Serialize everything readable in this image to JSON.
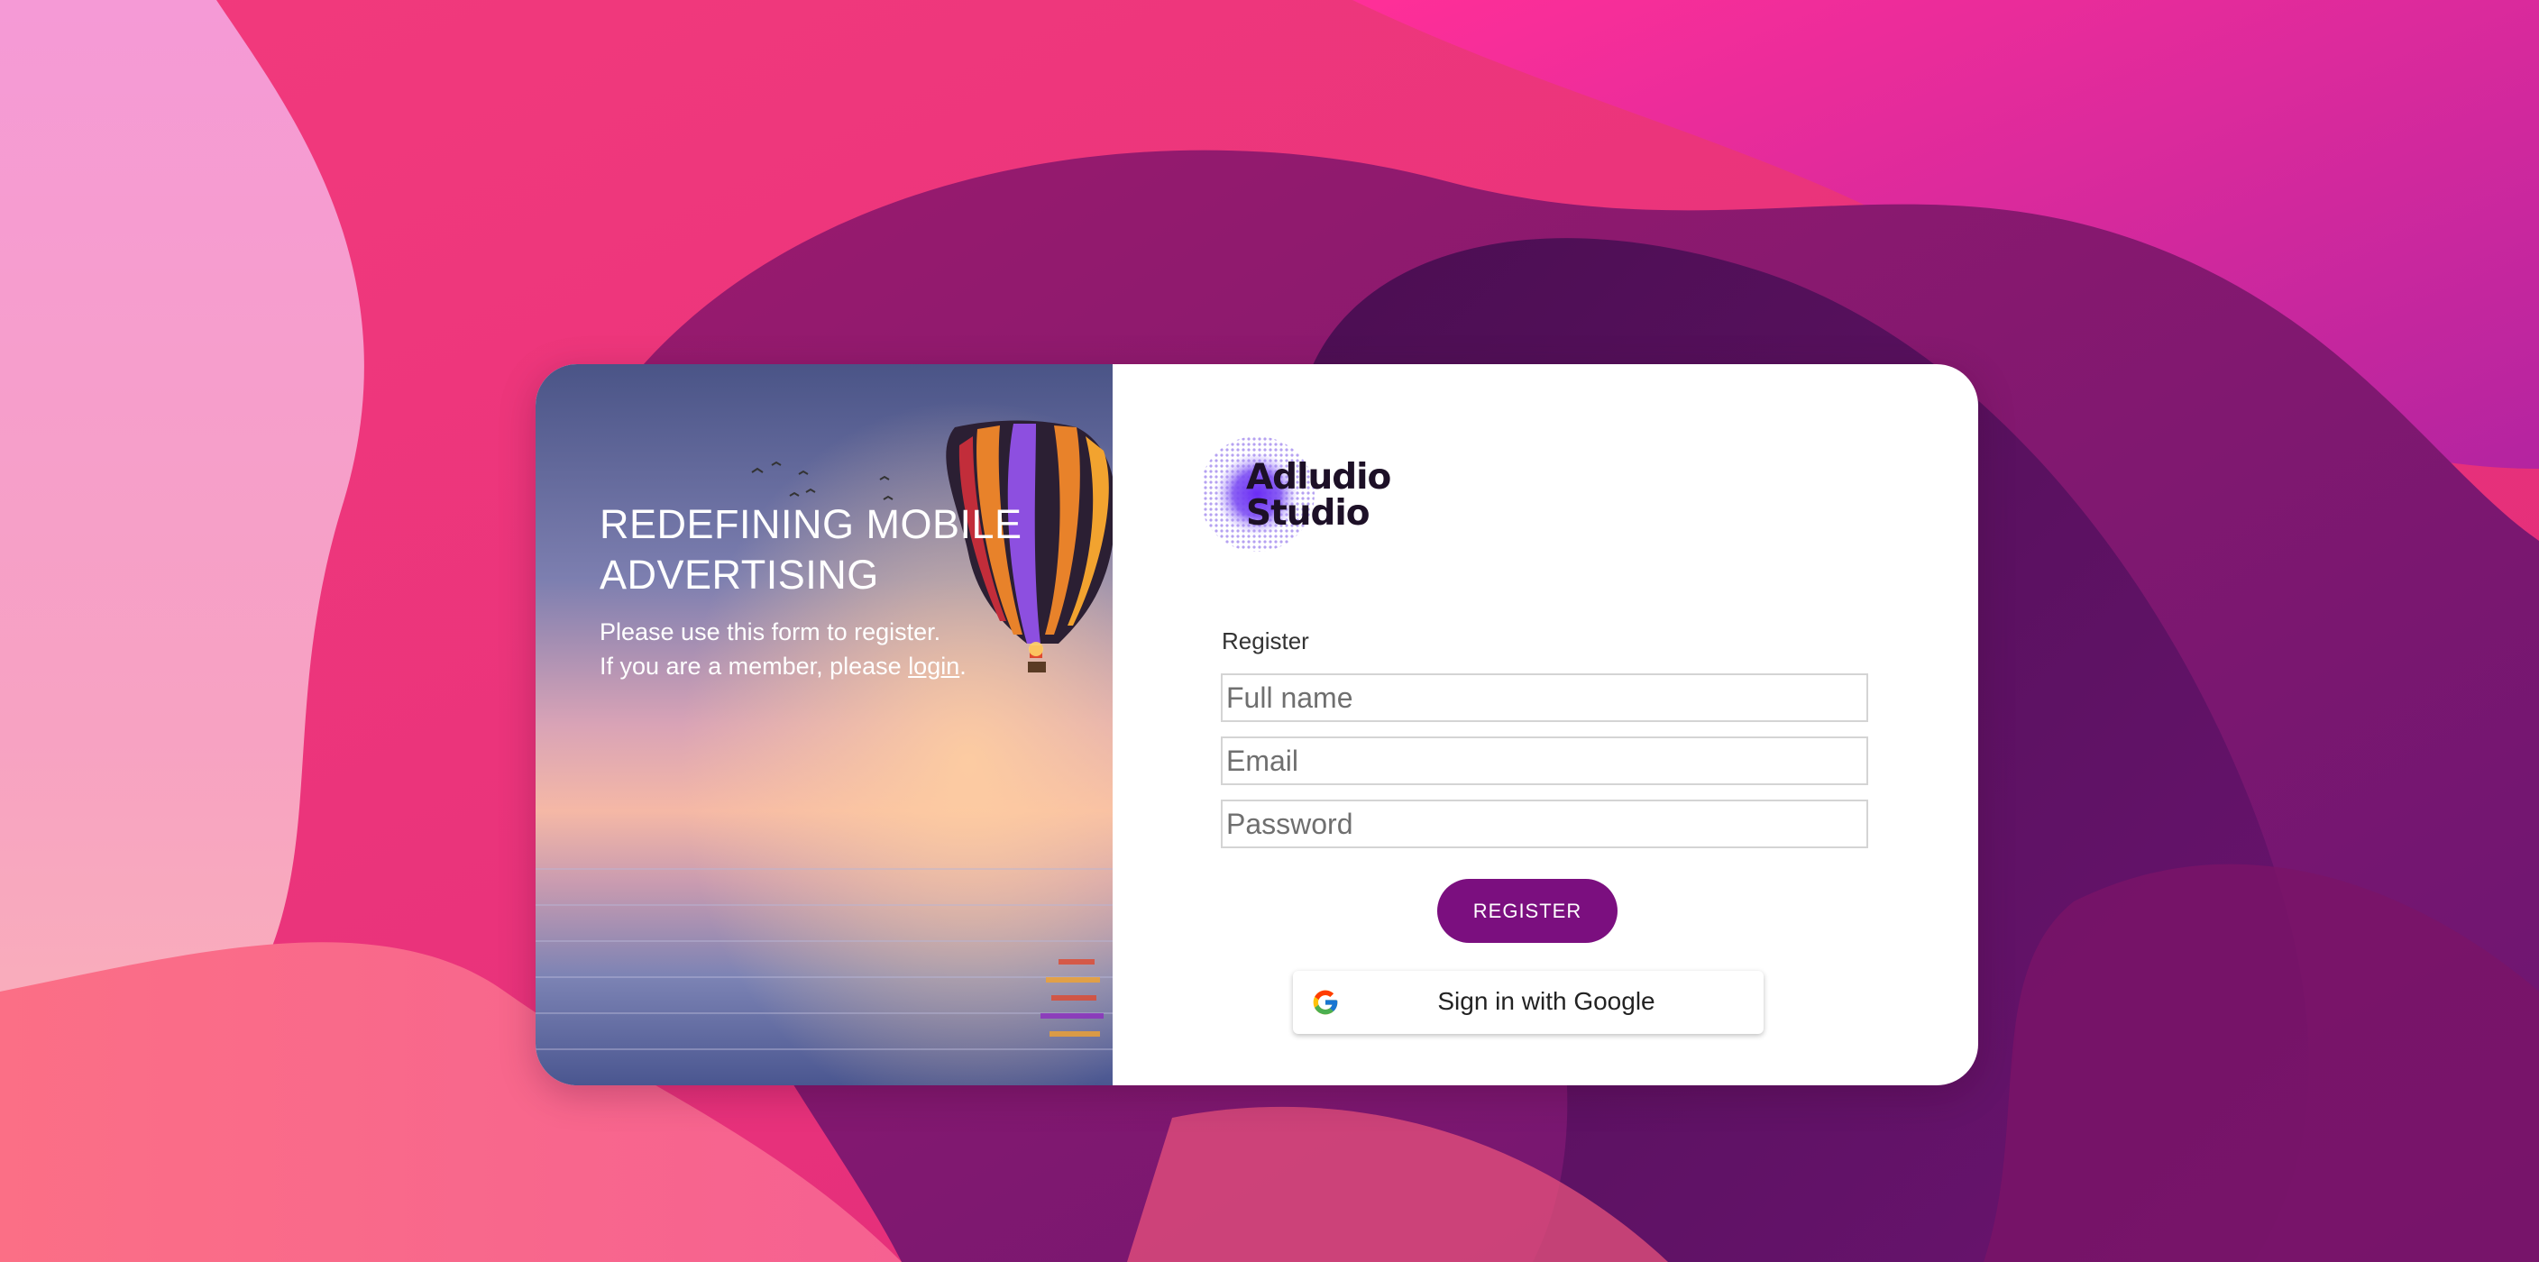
{
  "colors": {
    "accent": "#7b0f7f",
    "card_background": "#ffffff",
    "field_border": "#d4d4d4",
    "hero_text": "#ffffff"
  },
  "hero": {
    "title": "REDEFINING MOBILE ADVERTISING",
    "subtitle_line1": "Please use this form to register.",
    "subtitle_line2_prefix": "If you are a member, please ",
    "login_link": "login",
    "subtitle_line2_suffix": ".",
    "image_icon": "hot-air-balloon-over-sea-image"
  },
  "logo": {
    "text": "Adludio Studio",
    "icon": "adludio-logo-icon"
  },
  "form": {
    "label": "Register",
    "full_name_placeholder": "Full name",
    "email_placeholder": "Email",
    "password_placeholder": "Password",
    "full_name_value": "",
    "email_value": "",
    "password_value": "",
    "register_button": "REGISTER",
    "google_button": "Sign in with Google",
    "google_icon": "google-g-icon"
  }
}
